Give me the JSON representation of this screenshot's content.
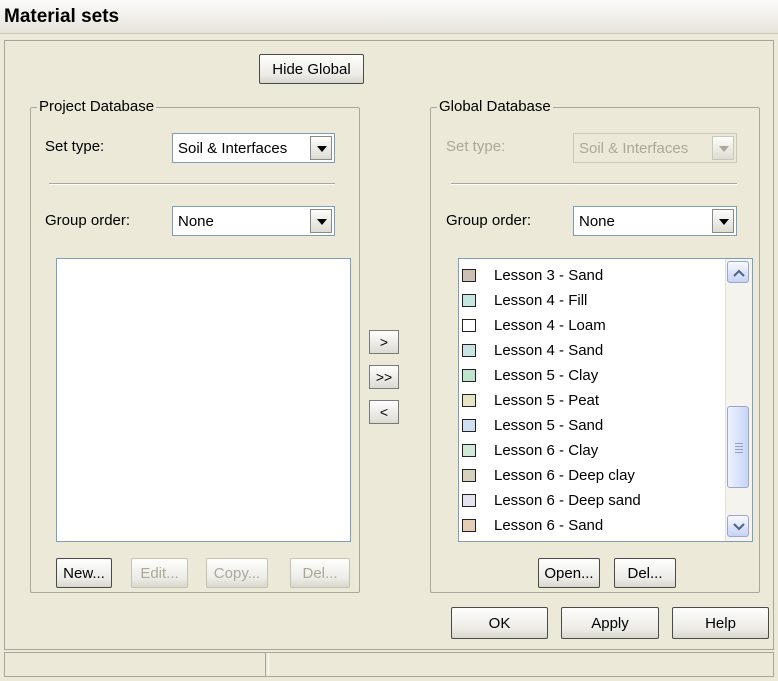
{
  "window": {
    "title": "Material sets"
  },
  "toolbar": {
    "hide_global_label": "Hide Global"
  },
  "project": {
    "legend": "Project Database",
    "set_type_label": "Set type:",
    "set_type_value": "Soil & Interfaces",
    "group_order_label": "Group order:",
    "group_order_value": "None",
    "items": [],
    "buttons": {
      "new": "New...",
      "edit": "Edit...",
      "copy": "Copy...",
      "del": "Del..."
    }
  },
  "transfer": {
    "copy_one": ">",
    "copy_all": ">>",
    "copy_back": "<"
  },
  "global": {
    "legend": "Global Database",
    "set_type_label": "Set type:",
    "set_type_value": "Soil & Interfaces",
    "group_order_label": "Group order:",
    "group_order_value": "None",
    "items": [
      {
        "label": "Lesson 3 - Sand",
        "color": "#cdbfb4"
      },
      {
        "label": "Lesson 4 - Fill",
        "color": "#c5e6e0"
      },
      {
        "label": "Lesson 4 - Loam",
        "color": "#ffffff"
      },
      {
        "label": "Lesson 4 - Sand",
        "color": "#c9e3e2"
      },
      {
        "label": "Lesson 5 - Clay",
        "color": "#bfe3cd"
      },
      {
        "label": "Lesson 5 - Peat",
        "color": "#e8e4c6"
      },
      {
        "label": "Lesson 5 - Sand",
        "color": "#d1def0"
      },
      {
        "label": "Lesson 6 - Clay",
        "color": "#cfe8d7"
      },
      {
        "label": "Lesson 6 - Deep clay",
        "color": "#d6d0bf"
      },
      {
        "label": "Lesson 6 - Deep sand",
        "color": "#e6e3f0"
      },
      {
        "label": "Lesson 6 - Sand",
        "color": "#e6cdb8"
      }
    ],
    "buttons": {
      "open": "Open...",
      "del": "Del..."
    }
  },
  "footer": {
    "ok": "OK",
    "apply": "Apply",
    "help": "Help"
  },
  "status": {
    "left": "",
    "right": ""
  }
}
